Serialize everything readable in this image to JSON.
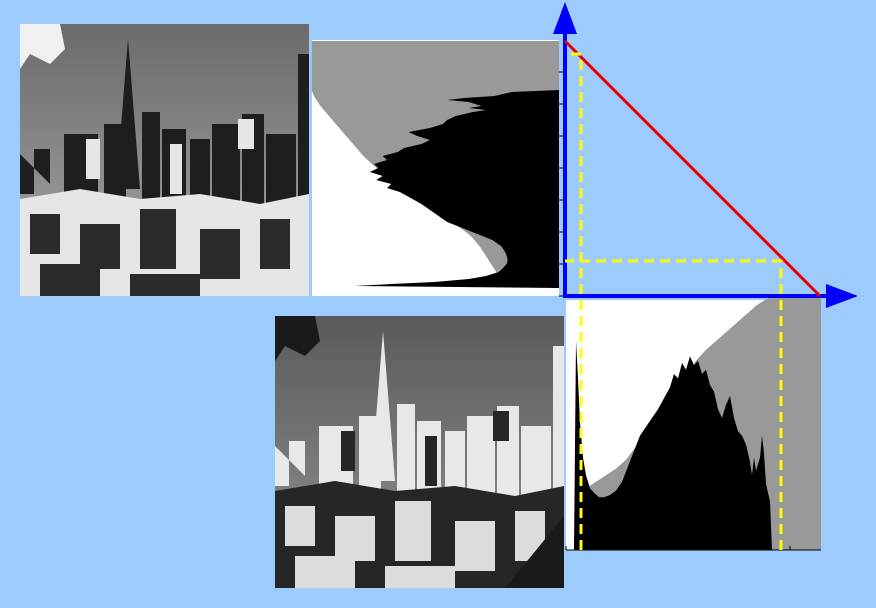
{
  "figure": {
    "description_free": true,
    "colors": {
      "background": "#9ecbfe",
      "axis": "#0000ff",
      "transfer_curve": "#e60000",
      "guide_line": "#ffff00",
      "histogram_fill": "#000000",
      "cumulative_fill": "#999999",
      "panel": "#ffffff"
    },
    "panels": {
      "output_image": {
        "role": "equalized-negative",
        "icon": "city-skyline-photo"
      },
      "input_image": {
        "role": "original",
        "icon": "city-skyline-photo"
      },
      "input_histogram": {
        "role": "histogram-with-cumulative"
      },
      "output_histogram": {
        "role": "rotated-histogram-with-cumulative"
      },
      "transfer_plot": {
        "role": "intensity-mapping"
      }
    }
  },
  "chart_data": [
    {
      "type": "area",
      "name_free": true,
      "x_range": [
        0,
        255
      ],
      "histogram": [
        [
          0,
          0
        ],
        [
          8,
          0
        ],
        [
          10,
          95
        ],
        [
          12,
          78
        ],
        [
          14,
          58
        ],
        [
          17,
          42
        ],
        [
          20,
          34
        ],
        [
          24,
          28
        ],
        [
          28,
          26
        ],
        [
          33,
          24
        ],
        [
          38,
          24
        ],
        [
          44,
          25
        ],
        [
          50,
          27
        ],
        [
          56,
          31
        ],
        [
          62,
          38
        ],
        [
          68,
          45
        ],
        [
          74,
          52
        ],
        [
          80,
          56
        ],
        [
          86,
          60
        ],
        [
          92,
          64
        ],
        [
          98,
          69
        ],
        [
          104,
          74
        ],
        [
          108,
          80
        ],
        [
          112,
          78
        ],
        [
          116,
          85
        ],
        [
          120,
          82
        ],
        [
          124,
          88
        ],
        [
          128,
          84
        ],
        [
          132,
          86
        ],
        [
          136,
          80
        ],
        [
          140,
          82
        ],
        [
          144,
          75
        ],
        [
          148,
          72
        ],
        [
          152,
          64
        ],
        [
          156,
          60
        ],
        [
          160,
          66
        ],
        [
          164,
          70
        ],
        [
          168,
          60
        ],
        [
          172,
          54
        ],
        [
          176,
          52
        ],
        [
          180,
          48
        ],
        [
          184,
          40
        ],
        [
          186,
          34
        ],
        [
          188,
          42
        ],
        [
          190,
          36
        ],
        [
          194,
          42
        ],
        [
          196,
          52
        ],
        [
          198,
          44
        ],
        [
          200,
          30
        ],
        [
          204,
          22
        ],
        [
          206,
          0
        ],
        [
          255,
          0
        ]
      ],
      "cumulative": [
        [
          0,
          0
        ],
        [
          8,
          0
        ],
        [
          10,
          18
        ],
        [
          14,
          24
        ],
        [
          20,
          28
        ],
        [
          30,
          31
        ],
        [
          40,
          34
        ],
        [
          50,
          37
        ],
        [
          60,
          41
        ],
        [
          70,
          47
        ],
        [
          80,
          53
        ],
        [
          90,
          60
        ],
        [
          100,
          67
        ],
        [
          110,
          74
        ],
        [
          120,
          80
        ],
        [
          130,
          86
        ],
        [
          140,
          91
        ],
        [
          150,
          95
        ],
        [
          160,
          99
        ],
        [
          170,
          103
        ],
        [
          180,
          107
        ],
        [
          190,
          111
        ],
        [
          200,
          114
        ],
        [
          206,
          115
        ],
        [
          255,
          115
        ]
      ]
    },
    {
      "type": "line",
      "x_range": [
        0,
        255
      ],
      "y_range": [
        0,
        255
      ],
      "transfer": [
        [
          0,
          255
        ],
        [
          255,
          0
        ]
      ],
      "guides": {
        "low_input": 10,
        "high_input": 206
      }
    }
  ]
}
